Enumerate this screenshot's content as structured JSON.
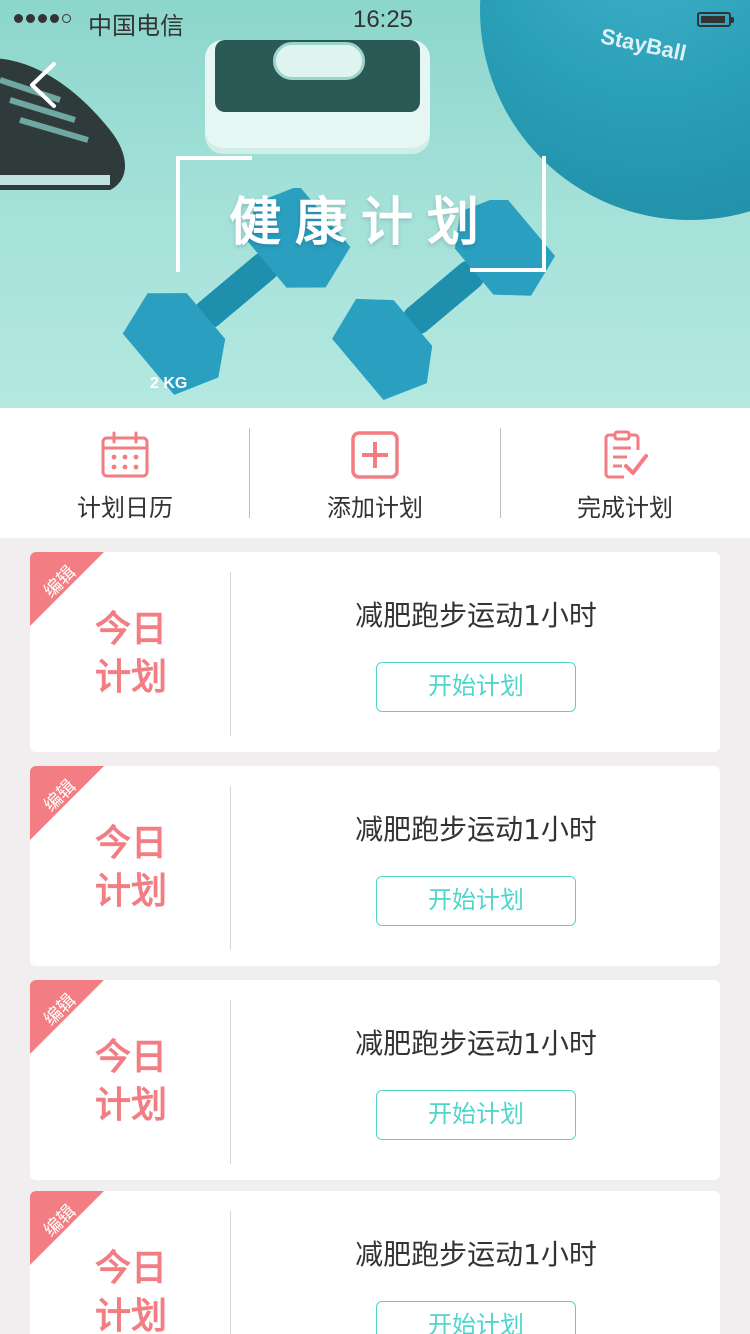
{
  "status_bar": {
    "carrier": "中国电信",
    "time": "16:25"
  },
  "hero": {
    "title": "健康计划",
    "ball_brand": "StayBall",
    "dumbbell_label": "2 KG"
  },
  "colors": {
    "accent_pink": "#f27d82",
    "accent_teal": "#4fd6cc",
    "hero_tint": "#8cd6cc"
  },
  "actions": [
    {
      "label": "计划日历",
      "icon": "calendar-icon"
    },
    {
      "label": "添加计划",
      "icon": "plus-square-icon"
    },
    {
      "label": "完成计划",
      "icon": "checklist-icon"
    }
  ],
  "cards": [
    {
      "ribbon": "编辑",
      "today_line1": "今日",
      "today_line2": "计划",
      "title": "减肥跑步运动1小时",
      "button": "开始计划"
    },
    {
      "ribbon": "编辑",
      "today_line1": "今日",
      "today_line2": "计划",
      "title": "减肥跑步运动1小时",
      "button": "开始计划"
    },
    {
      "ribbon": "编辑",
      "today_line1": "今日",
      "today_line2": "计划",
      "title": "减肥跑步运动1小时",
      "button": "开始计划"
    },
    {
      "ribbon": "编辑",
      "today_line1": "今日",
      "today_line2": "计划",
      "title": "减肥跑步运动1小时",
      "button": "开始计划"
    }
  ]
}
